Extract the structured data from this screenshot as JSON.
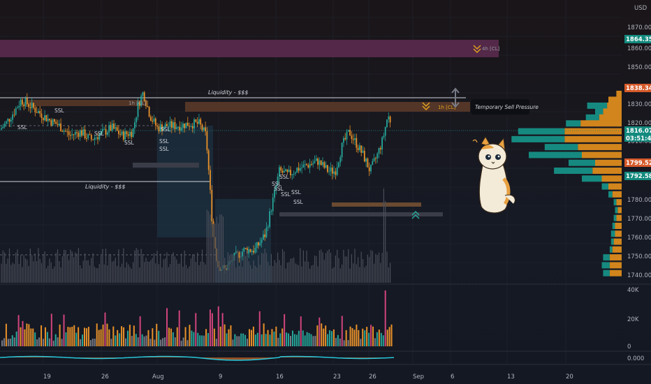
{
  "colors": {
    "background": "#161a25",
    "up": "#26a69a",
    "down": "#e8912a",
    "neutral": "#787b86",
    "pink": "#d0447c",
    "zone_purple": "#5a2a4e",
    "zone_brown": "#5a3a28",
    "vp_teal": "#168a80",
    "vp_orange": "#d1851c"
  },
  "price_axis": {
    "currency": "USD",
    "ticks": [
      "1870.000",
      "1860.000",
      "1850.000",
      "1830.000",
      "1820.000",
      "1810.000",
      "1780.000",
      "1770.000",
      "1760.000",
      "1750.000",
      "1740.000"
    ],
    "tags": [
      {
        "label": "1864.351",
        "color": "#138a7e"
      },
      {
        "label": "1838.347",
        "color": "#d65a2a"
      },
      {
        "label": "1816.070",
        "color": "#138a7e"
      },
      {
        "label": "03:51:45",
        "color": "#138a7e"
      },
      {
        "label": "1799.520",
        "color": "#d65a2a"
      },
      {
        "label": "1792.582",
        "color": "#138a7e"
      }
    ]
  },
  "volume_axis": {
    "ticks": [
      "40K",
      "20K",
      "0"
    ]
  },
  "osc_axis": {
    "ticks": [
      "0.000"
    ]
  },
  "time_axis": {
    "ticks": [
      "19",
      "26",
      "Aug",
      "9",
      "16",
      "23",
      "26",
      "Sep",
      "6",
      "13",
      "20"
    ]
  },
  "annotations": {
    "liquidity_top": "Liquidity - $$$",
    "liquidity_bottom": "Liquidity - $$$",
    "zone_4h_label": "4h [CL]",
    "zone_1h_label": "1h [CL]",
    "zone_1h_label_left": "1h [CL]",
    "callout": "Temporary Sell Pressure",
    "ssl": [
      "SSL",
      "SSL",
      "SSL",
      "SSL",
      "SSL",
      "SSL",
      "SSL",
      "SSL",
      "SSL",
      "SSL",
      "SSL",
      "SSL",
      "SSL"
    ]
  },
  "chart_data": {
    "type": "candlestick",
    "y_range": [
      1736,
      1876
    ],
    "volume_range": [
      0,
      40000
    ],
    "levels": {
      "liquidity_top": 1834,
      "liquidity_bottom": 1794,
      "last_price": 1816.07,
      "zone_4h": [
        1857,
        1864.351
      ],
      "zone_1h": [
        1827,
        1831
      ]
    },
    "volume_profile": {
      "rows": [
        {
          "price": 1831,
          "up": 0,
          "down": 8
        },
        {
          "price": 1828,
          "up": 0,
          "down": 20
        },
        {
          "price": 1825,
          "up": 30,
          "down": 22
        },
        {
          "price": 1822,
          "up": 12,
          "down": 28
        },
        {
          "price": 1819,
          "up": 20,
          "down": 34
        },
        {
          "price": 1816,
          "up": 22,
          "down": 62
        },
        {
          "price": 1812,
          "up": 70,
          "down": 86
        },
        {
          "price": 1808,
          "up": 80,
          "down": 86
        },
        {
          "price": 1804,
          "up": 50,
          "down": 66
        },
        {
          "price": 1800,
          "up": 80,
          "down": 60
        },
        {
          "price": 1796,
          "up": 40,
          "down": 40
        },
        {
          "price": 1792,
          "up": 58,
          "down": 44
        },
        {
          "price": 1788,
          "up": 30,
          "down": 30
        },
        {
          "price": 1784,
          "up": 10,
          "down": 20
        },
        {
          "price": 1780,
          "up": 6,
          "down": 14
        },
        {
          "price": 1776,
          "up": 4,
          "down": 8
        },
        {
          "price": 1772,
          "up": 4,
          "down": 6
        },
        {
          "price": 1768,
          "up": 4,
          "down": 8
        },
        {
          "price": 1764,
          "up": 4,
          "down": 10
        },
        {
          "price": 1760,
          "up": 6,
          "down": 10
        },
        {
          "price": 1756,
          "up": 4,
          "down": 12
        },
        {
          "price": 1752,
          "up": 4,
          "down": 14
        },
        {
          "price": 1748,
          "up": 10,
          "down": 18
        },
        {
          "price": 1744,
          "up": 12,
          "down": 18
        },
        {
          "price": 1740,
          "up": 10,
          "down": 18
        }
      ]
    }
  }
}
